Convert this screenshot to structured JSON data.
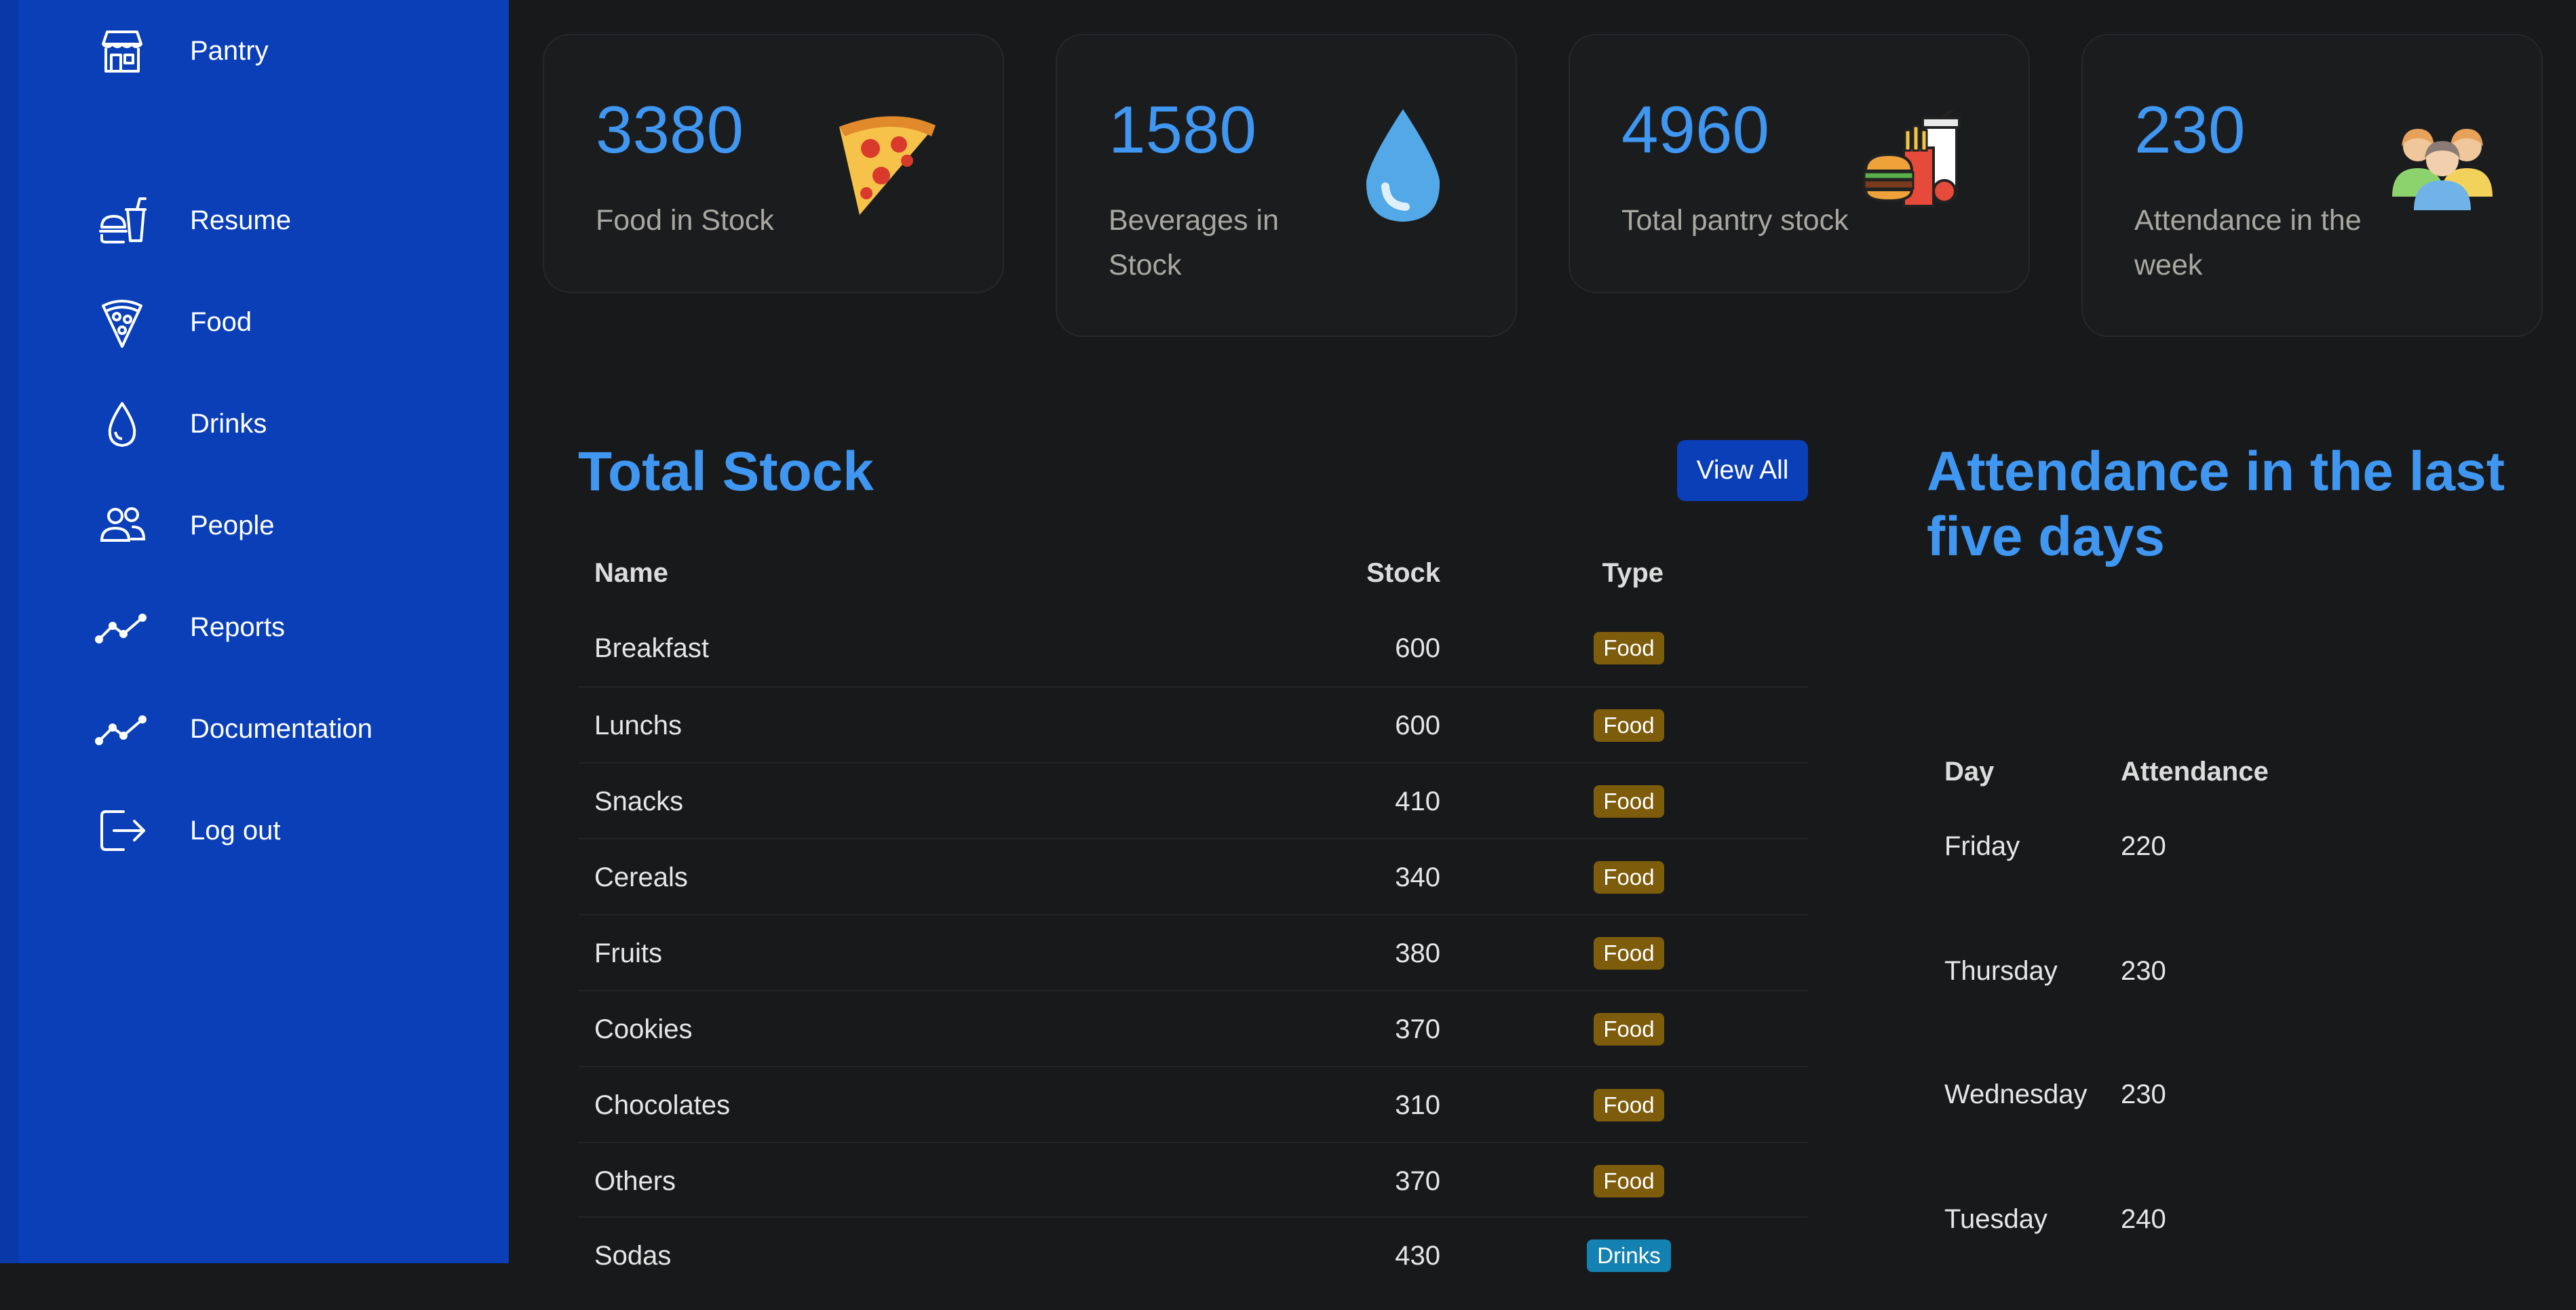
{
  "sidebar": {
    "items": [
      {
        "label": "Pantry",
        "icon": "store-icon"
      },
      {
        "label": "Resume",
        "icon": "fastfood-icon"
      },
      {
        "label": "Food",
        "icon": "pizza-icon"
      },
      {
        "label": "Drinks",
        "icon": "drop-icon"
      },
      {
        "label": "People",
        "icon": "people-icon"
      },
      {
        "label": "Reports",
        "icon": "trend-icon"
      },
      {
        "label": "Documentation",
        "icon": "trend-icon"
      },
      {
        "label": "Log out",
        "icon": "logout-icon"
      }
    ]
  },
  "cards": [
    {
      "value": "3380",
      "label": "Food in Stock",
      "icon": "pizza-slice-icon"
    },
    {
      "value": "1580",
      "label": "Beverages in Stock",
      "icon": "water-drop-icon"
    },
    {
      "value": "4960",
      "label": "Total pantry stock",
      "icon": "burger-fries-drink-icon"
    },
    {
      "value": "230",
      "label": "Attendance in the week",
      "icon": "group-people-icon"
    }
  ],
  "stock": {
    "title": "Total Stock",
    "view_all_label": "View All",
    "headers": {
      "name": "Name",
      "stock": "Stock",
      "type": "Type"
    },
    "rows": [
      {
        "name": "Breakfast",
        "stock": "600",
        "type": "Food"
      },
      {
        "name": "Lunchs",
        "stock": "600",
        "type": "Food"
      },
      {
        "name": "Snacks",
        "stock": "410",
        "type": "Food"
      },
      {
        "name": "Cereals",
        "stock": "340",
        "type": "Food"
      },
      {
        "name": "Fruits",
        "stock": "380",
        "type": "Food"
      },
      {
        "name": "Cookies",
        "stock": "370",
        "type": "Food"
      },
      {
        "name": "Chocolates",
        "stock": "310",
        "type": "Food"
      },
      {
        "name": "Others",
        "stock": "370",
        "type": "Food"
      },
      {
        "name": "Sodas",
        "stock": "430",
        "type": "Drinks"
      }
    ]
  },
  "attendance": {
    "title": "Attendance in the last five days",
    "headers": {
      "day": "Day",
      "attendance": "Attendance"
    },
    "rows": [
      {
        "day": "Friday",
        "value": "220"
      },
      {
        "day": "Thursday",
        "value": "230"
      },
      {
        "day": "Wednesday",
        "value": "230"
      },
      {
        "day": "Tuesday",
        "value": "240"
      }
    ]
  },
  "colors": {
    "sidebar": "#0a3fb8",
    "accent": "#3f97f2",
    "food_badge": "#7d5c0c",
    "drinks_badge": "#1481b3",
    "background": "#18191b"
  }
}
